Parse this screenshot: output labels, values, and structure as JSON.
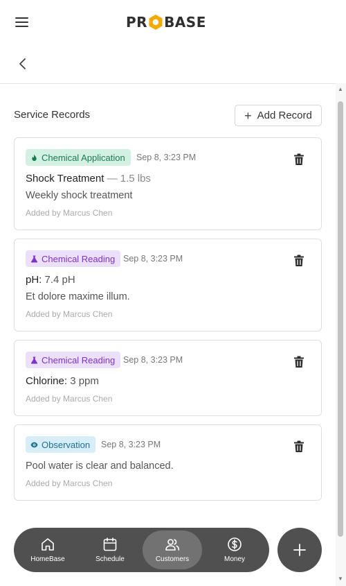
{
  "header": {
    "logo_left": "PR",
    "logo_right": "BASE"
  },
  "section": {
    "title": "Service Records",
    "add_button_label": "Add Record"
  },
  "records": [
    {
      "type_label": "Chemical Application",
      "timestamp": "Sep 8, 3:23 PM",
      "title": "Shock Treatment",
      "title_suffix": "— 1.5 lbs",
      "description": "Weekly shock treatment",
      "added_by": "Added by Marcus Chen"
    },
    {
      "type_label": "Chemical Reading",
      "timestamp": "Sep 8, 3:23 PM",
      "title": "pH:",
      "value": "7.4 pH",
      "description": "Et dolore maxime illum.",
      "added_by": "Added by Marcus Chen"
    },
    {
      "type_label": "Chemical Reading",
      "timestamp": "Sep 8, 3:23 PM",
      "title": "Chlorine:",
      "value": "3 ppm",
      "added_by": "Added by Marcus Chen"
    },
    {
      "type_label": "Observation",
      "timestamp": "Sep 8, 3:23 PM",
      "description": "Pool water is clear and balanced.",
      "added_by": "Added by Marcus Chen"
    }
  ],
  "nav": {
    "items": [
      {
        "label": "HomeBase",
        "icon": "home-icon"
      },
      {
        "label": "Schedule",
        "icon": "calendar-icon"
      },
      {
        "label": "Customers",
        "icon": "users-icon",
        "active": true
      },
      {
        "label": "Money",
        "icon": "dollar-icon"
      }
    ]
  },
  "colors": {
    "application_badge": "#d2f1e3",
    "reading_badge": "#ebdff9",
    "observation_badge": "#d7eef8",
    "nav_background": "#505050",
    "logo_accent": "#f2a900"
  }
}
